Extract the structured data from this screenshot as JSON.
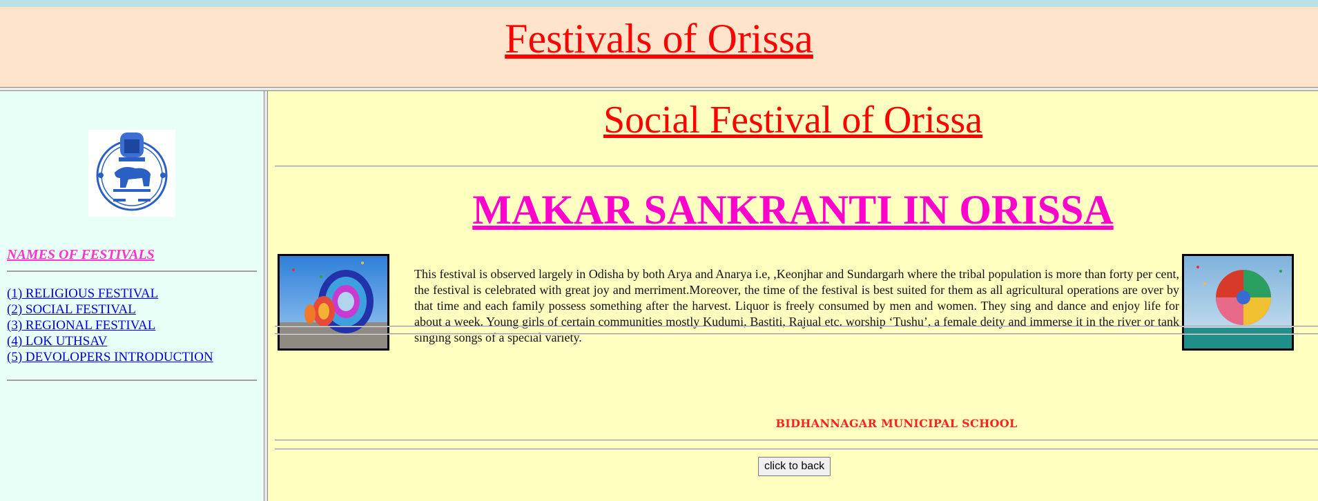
{
  "header": {
    "title": "Festivals of Orissa"
  },
  "sidebar": {
    "nav_title": "NAMES OF FESTIVALS",
    "items": [
      {
        "label": "(1) RELIGIOUS FESTIVAL"
      },
      {
        "label": "(2) SOCIAL FESTIVAL"
      },
      {
        "label": "(3) REGIONAL FESTIVAL"
      },
      {
        "label": "(4) LOK UTHSAV"
      },
      {
        "label": "(5) DEVOLOPERS INTRODUCTION"
      }
    ]
  },
  "main": {
    "title": "Social Festival of Orissa",
    "festival_title": "MAKAR SANKRANTI IN ORISSA",
    "description": "This festival is observed largely in Odisha by both Arya and Anarya i.e, ,Keonjhar and Sundargarh where the tribal population is more than forty per cent, the festival is celebrated with great joy and merriment.Moreover, the time of the festival is best suited for them as all agricultural operations are over by that time and each family possess something after the harvest. Liquor is freely consumed by men and women. They sing and dance and enjoy life for about a week. Young girls of certain communities mostly Kudumi, Bastiti, Rajual etc. worship ‘Tushu’, a female deity and immerse it in the river or tank singing songs of a special variety.",
    "school": "BIDHANNAGAR MUNICIPAL SCHOOL",
    "back_button": "click to back"
  },
  "colors": {
    "header_bg": "#ffe4cc",
    "sidebar_bg": "#e8fff8",
    "main_bg": "#ffffc0",
    "title_red": "#ff0000",
    "festival_magenta": "#ff00cc",
    "link_blue": "#0000dd"
  },
  "icons": {
    "emblem": "odisha-emblem-icon"
  }
}
